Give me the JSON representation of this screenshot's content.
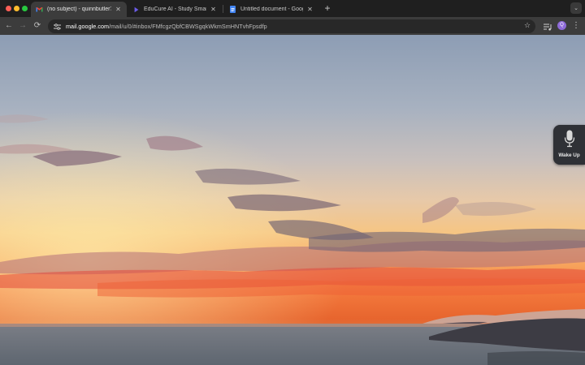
{
  "browser": {
    "tabs": [
      {
        "title": "(no subject) - quinnbutler71@",
        "favicon": "gmail-icon",
        "active": true
      },
      {
        "title": "EduCure AI - Study Smarter",
        "favicon": "educure-icon",
        "active": false
      },
      {
        "title": "Untitled document - Google D",
        "favicon": "google-docs-icon",
        "active": false
      }
    ],
    "new_tab_label": "+",
    "tab_menu_label": "⌄"
  },
  "toolbar": {
    "url_host": "mail.google.com",
    "url_path": "/mail/u/0/#inbox/FMfcgzQbfCBWSgqkWkmSmHNTvhFpsdfp",
    "profile_initial": "Q"
  },
  "widget": {
    "label": "Wake Up",
    "icon": "microphone-icon"
  },
  "colors": {
    "tabstrip": "#1f1f1f",
    "toolbar": "#3c3c3c",
    "omnibox": "#282828",
    "profile": "#8e6ad8",
    "widget": "#2f3136"
  }
}
